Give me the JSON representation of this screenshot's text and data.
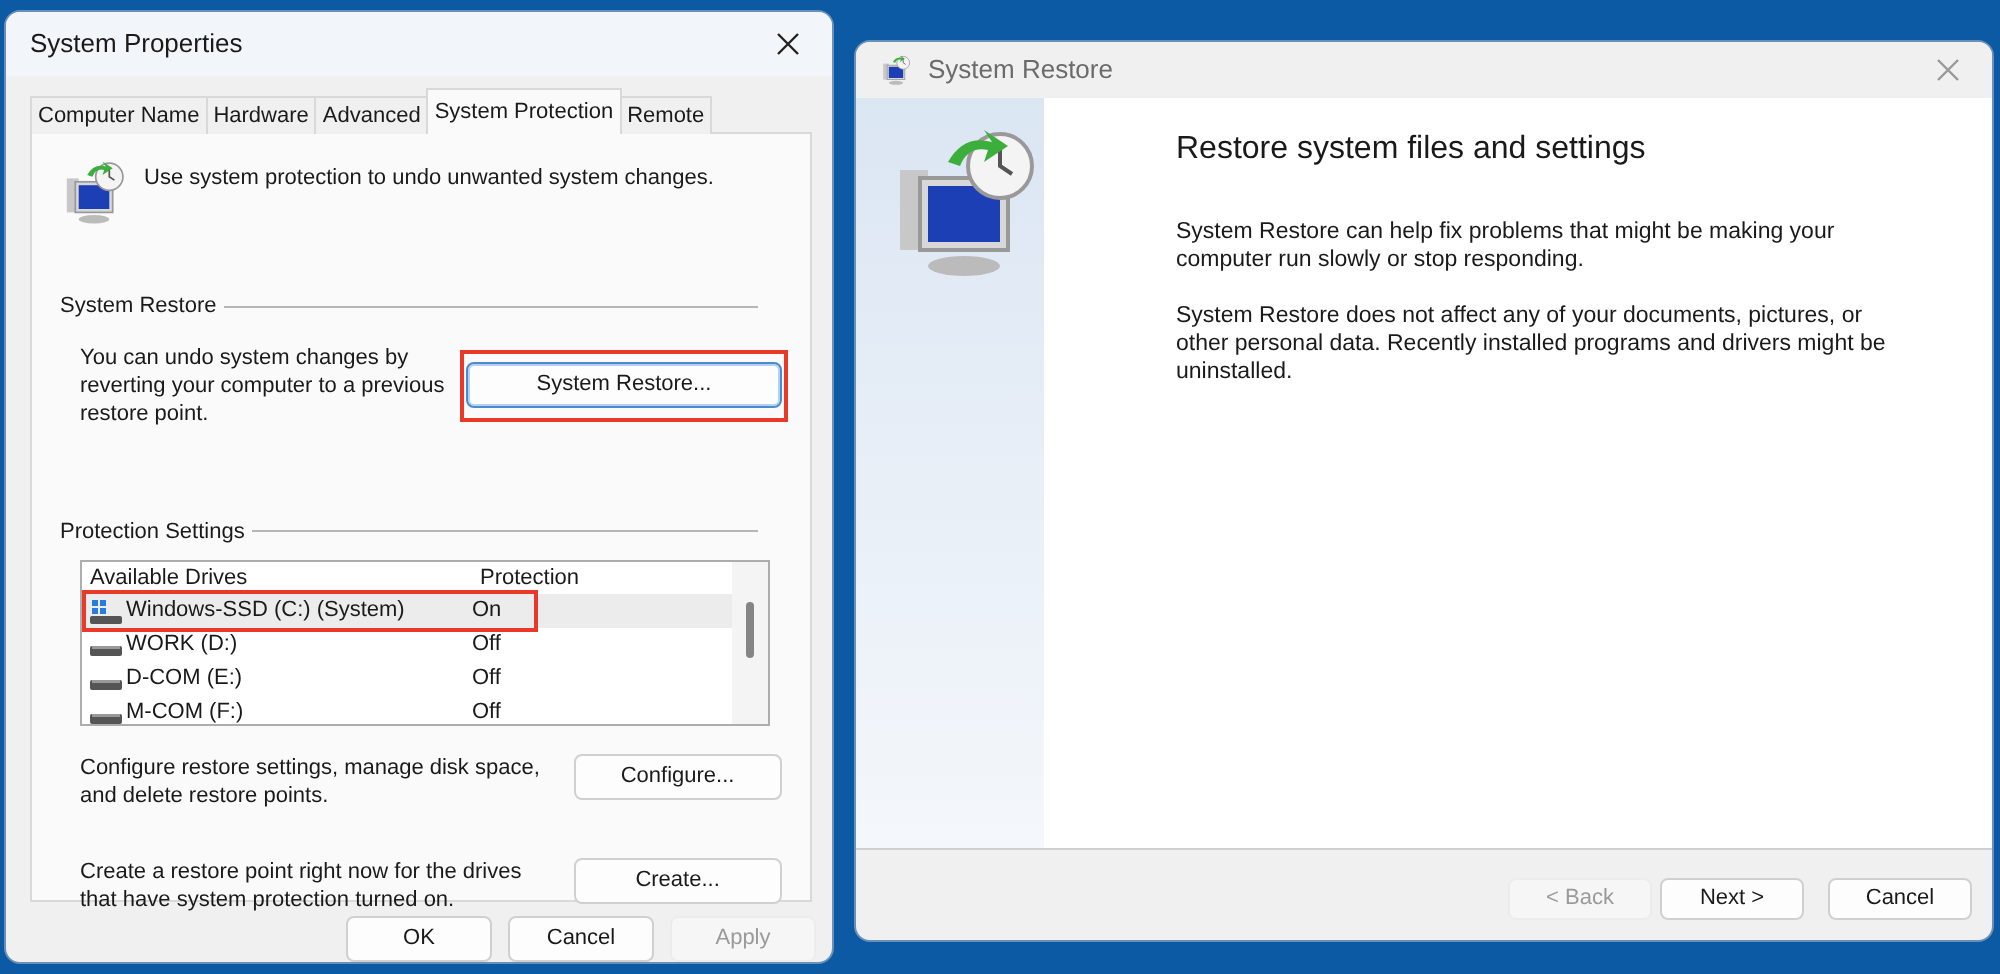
{
  "system_properties": {
    "title": "System Properties",
    "tabs": [
      {
        "label": "Computer Name",
        "selected": false
      },
      {
        "label": "Hardware",
        "selected": false
      },
      {
        "label": "Advanced",
        "selected": false
      },
      {
        "label": "System Protection",
        "selected": true
      },
      {
        "label": "Remote",
        "selected": false
      }
    ],
    "intro": "Use system protection to undo unwanted system changes.",
    "system_restore": {
      "heading": "System Restore",
      "description": "You can undo system changes by reverting your computer to a previous restore point.",
      "button": {
        "label": "System Restore...",
        "focused": true,
        "highlighted": true
      }
    },
    "protection_settings": {
      "heading": "Protection Settings",
      "columns": [
        "Available Drives",
        "Protection"
      ],
      "drives": [
        {
          "kind": "system",
          "name": "Windows-SSD (C:) (System)",
          "protection": "On",
          "selected": true,
          "highlighted": true
        },
        {
          "kind": "disk",
          "name": "WORK (D:)",
          "protection": "Off",
          "selected": false,
          "highlighted": false
        },
        {
          "kind": "disk",
          "name": "D-COM (E:)",
          "protection": "Off",
          "selected": false,
          "highlighted": false
        },
        {
          "kind": "disk",
          "name": "M-COM (F:)",
          "protection": "Off",
          "selected": false,
          "highlighted": false
        }
      ],
      "actions": [
        {
          "description": "Configure restore settings, manage disk space, and delete restore points.",
          "button": "Configure..."
        },
        {
          "description": "Create a restore point right now for the drives that have system protection turned on.",
          "button": "Create..."
        }
      ]
    },
    "buttons": [
      {
        "label": "OK",
        "disabled": false
      },
      {
        "label": "Cancel",
        "disabled": false
      },
      {
        "label": "Apply",
        "disabled": true
      }
    ]
  },
  "system_restore_wizard": {
    "title": "System Restore",
    "heading": "Restore system files and settings",
    "paragraphs": [
      "System Restore can help fix problems that might be making your computer run slowly or stop responding.",
      "System Restore does not affect any of your documents, pictures, or other personal data. Recently installed programs and drivers might be uninstalled."
    ],
    "buttons": [
      {
        "label": "< Back",
        "disabled": true
      },
      {
        "label": "Next >",
        "disabled": false
      },
      {
        "label": "Cancel",
        "disabled": false
      }
    ]
  }
}
